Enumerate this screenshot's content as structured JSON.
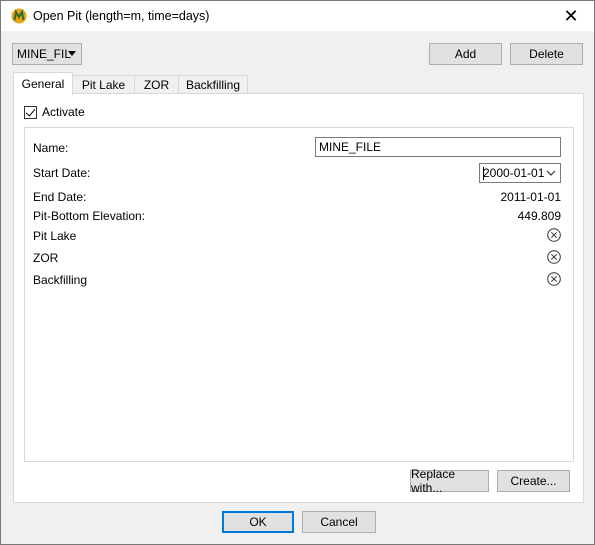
{
  "window": {
    "title": "Open Pit (length=m, time=days)",
    "close_glyph": "✕"
  },
  "selector": {
    "value": "MINE_FIL"
  },
  "top_buttons": {
    "add": "Add",
    "delete": "Delete"
  },
  "tabs": [
    {
      "label": "General",
      "active": true
    },
    {
      "label": "Pit Lake",
      "active": false
    },
    {
      "label": "ZOR",
      "active": false
    },
    {
      "label": "Backfilling",
      "active": false
    }
  ],
  "general": {
    "activate_label": "Activate",
    "activate_checked": true,
    "fields": {
      "name_label": "Name:",
      "name_value": "MINE_FILE",
      "start_label": "Start Date:",
      "start_value": "2000-01-01",
      "end_label": "End Date:",
      "end_value": "2011-01-01",
      "elev_label": "Pit-Bottom Elevation:",
      "elev_value": "449.809",
      "pitlake_label": "Pit Lake",
      "zor_label": "ZOR",
      "backfill_label": "Backfilling"
    },
    "replace_button": "Replace with...",
    "create_button": "Create..."
  },
  "dialog_buttons": {
    "ok": "OK",
    "cancel": "Cancel"
  },
  "icons": {
    "app": "app-logo-icon",
    "status": "x-circle-icon"
  },
  "colors": {
    "focus_border": "#0078d7",
    "logo_orange": "#e8a317",
    "logo_green": "#3a8a3a"
  }
}
